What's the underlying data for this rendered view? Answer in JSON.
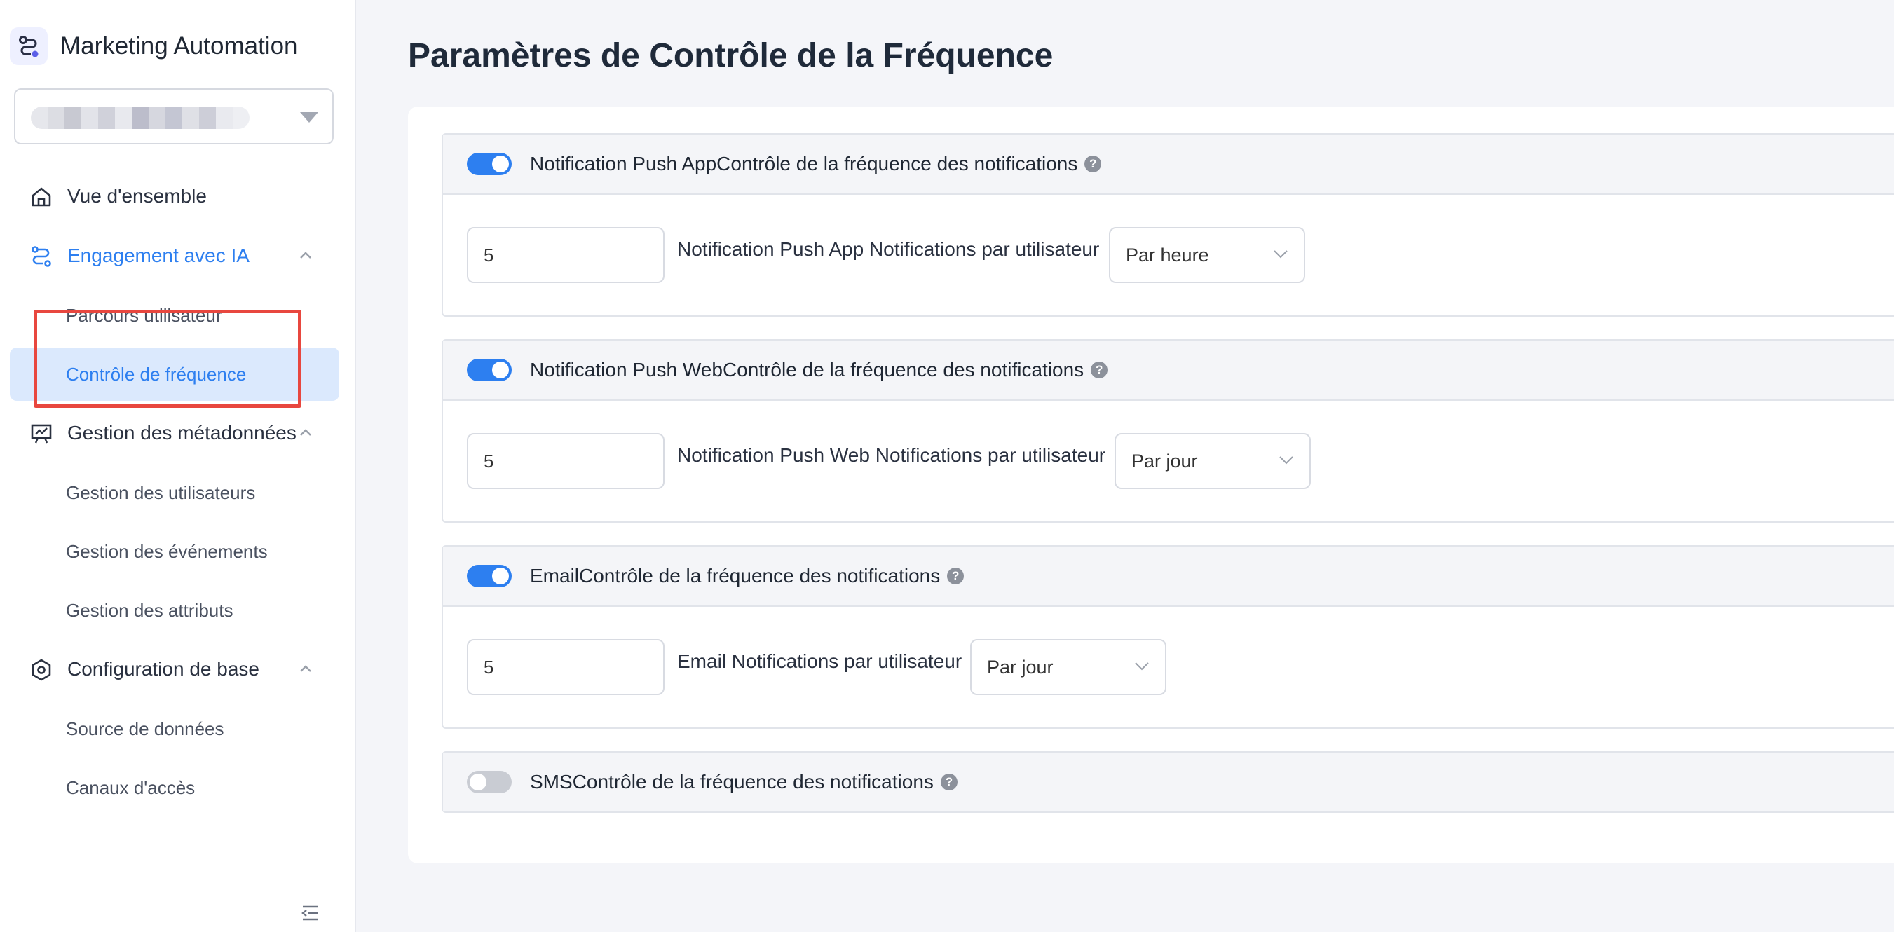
{
  "app": {
    "title": "Marketing Automation"
  },
  "sidebar": {
    "nav": [
      {
        "label": "Vue d'ensemble",
        "icon": "home-icon"
      },
      {
        "label": "Engagement avec IA",
        "icon": "flow-icon",
        "expanded": true,
        "children": [
          "Parcours utilisateur",
          "Contrôle de fréquence"
        ]
      },
      {
        "label": "Gestion des métadonnées",
        "icon": "presentation-icon",
        "expanded": true,
        "children": [
          "Gestion des utilisateurs",
          "Gestion des événements",
          "Gestion des attributs"
        ]
      },
      {
        "label": "Configuration de base",
        "icon": "settings-hexagon-icon",
        "expanded": true,
        "children": [
          "Source de données",
          "Canaux d'accès"
        ]
      }
    ],
    "selected": "Contrôle de fréquence"
  },
  "colors": {
    "accent": "#2d7ff0",
    "highlight": "#e8473f",
    "selected_bg": "#dbe9fd"
  },
  "page": {
    "title": "Paramètres de Contrôle de la Fréquence"
  },
  "channels": [
    {
      "enabled": true,
      "title": "Notification Push AppContrôle de la fréquence des notifications",
      "value": "5",
      "label": "Notification Push App Notifications par utilisateur",
      "period": "Par heure"
    },
    {
      "enabled": true,
      "title": "Notification Push WebContrôle de la fréquence des notifications",
      "value": "5",
      "label": "Notification Push Web Notifications par utilisateur",
      "period": "Par jour"
    },
    {
      "enabled": true,
      "title": "EmailContrôle de la fréquence des notifications",
      "value": "5",
      "label": "Email Notifications par utilisateur",
      "period": "Par jour"
    },
    {
      "enabled": false,
      "title": "SMSContrôle de la fréquence des notifications"
    }
  ],
  "help_glyph": "?"
}
